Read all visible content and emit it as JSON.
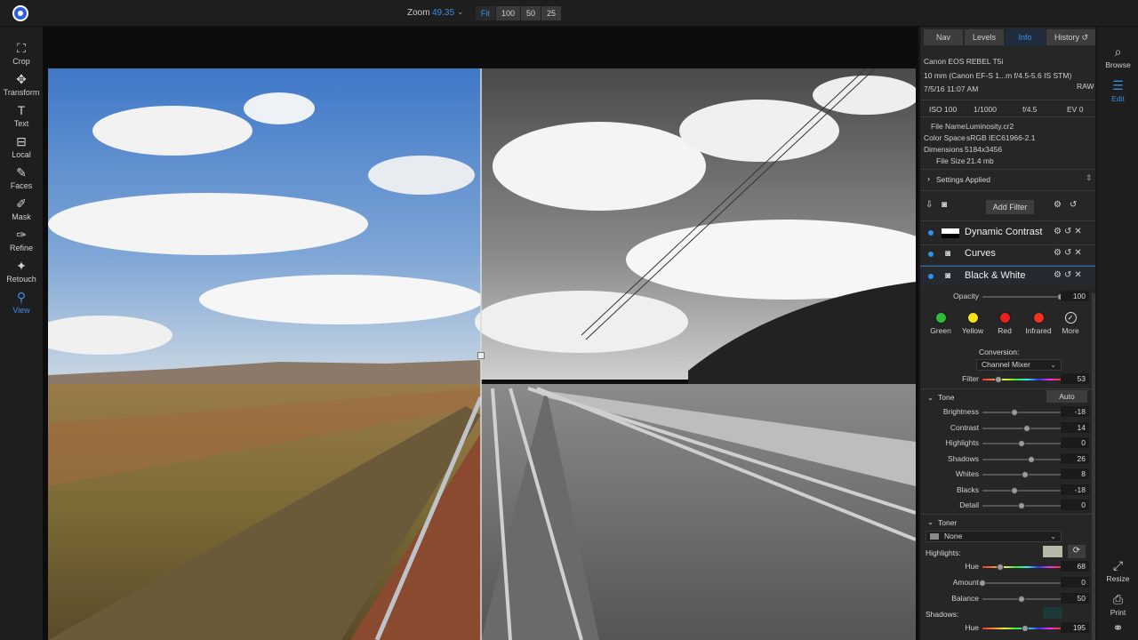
{
  "topbar": {
    "zoom_label": "Zoom",
    "zoom_value": "49.35",
    "zoom_buttons": [
      "Fit",
      "100",
      "50",
      "25"
    ]
  },
  "left_tools": [
    {
      "label": "Crop",
      "icon": "crop-icon"
    },
    {
      "label": "Transform",
      "icon": "transform-icon"
    },
    {
      "label": "Text",
      "icon": "text-icon"
    },
    {
      "label": "Local",
      "icon": "local-icon"
    },
    {
      "label": "Faces",
      "icon": "faces-icon"
    },
    {
      "label": "Mask",
      "icon": "mask-icon"
    },
    {
      "label": "Refine",
      "icon": "refine-icon"
    },
    {
      "label": "Retouch",
      "icon": "retouch-icon"
    },
    {
      "label": "View",
      "icon": "view-icon"
    }
  ],
  "right_tools": [
    {
      "label": "Browse",
      "icon": "browse-icon"
    },
    {
      "label": "Edit",
      "icon": "edit-icon"
    },
    {
      "label": "Resize",
      "icon": "resize-icon"
    },
    {
      "label": "Print",
      "icon": "print-icon"
    }
  ],
  "panel": {
    "tabs": [
      "Nav",
      "Levels",
      "Info",
      "History"
    ],
    "camera": "Canon EOS REBEL T5i",
    "lens": "10 mm (Canon EF-S 1...m f/4.5-5.6 IS STM)",
    "datetime": "7/5/16 11:07 AM",
    "format": "RAW",
    "exif": [
      "ISO 100",
      "1/1000",
      "f/4.5",
      "EV 0"
    ],
    "file_name_label": "File Name",
    "file_name": "Luminosity.cr2",
    "color_space_label": "Color Space",
    "color_space": "sRGB IEC61966-2.1",
    "dimensions_label": "Dimensions",
    "dimensions": "5184x3456",
    "file_size_label": "File Size",
    "file_size": "21.4 mb",
    "settings_applied": "Settings Applied",
    "add_filter": "Add Filter",
    "filters": [
      "Dynamic Contrast",
      "Curves",
      "Black & White"
    ],
    "opacity_label": "Opacity",
    "opacity_value": "100",
    "swatches": [
      {
        "label": "Green",
        "color": "#2ebd3a"
      },
      {
        "label": "Yellow",
        "color": "#f2e21a"
      },
      {
        "label": "Red",
        "color": "#e8201f"
      },
      {
        "label": "Infrared",
        "color": "#f0321e"
      },
      {
        "label": "More",
        "color": "#2a2a2a"
      }
    ],
    "conversion_label": "Conversion:",
    "conversion_value": "Channel Mixer",
    "filter_label": "Filter",
    "filter_value": "53",
    "tone_title": "Tone",
    "auto_label": "Auto",
    "tone_sliders": [
      {
        "label": "Brightness",
        "value": "-18",
        "pos": 0.41
      },
      {
        "label": "Contrast",
        "value": "14",
        "pos": 0.57
      },
      {
        "label": "Highlights",
        "value": "0",
        "pos": 0.5
      },
      {
        "label": "Shadows",
        "value": "26",
        "pos": 0.63
      },
      {
        "label": "Whites",
        "value": "8",
        "pos": 0.54
      },
      {
        "label": "Blacks",
        "value": "-18",
        "pos": 0.41
      },
      {
        "label": "Detail",
        "value": "0",
        "pos": 0.5
      }
    ],
    "toner_title": "Toner",
    "toner_value": "None",
    "highlights_label": "Highlights:",
    "hl_hue_label": "Hue",
    "hl_hue_value": "68",
    "amount_label": "Amount",
    "amount_value": "0",
    "balance_label": "Balance",
    "balance_value": "50",
    "shadows_label": "Shadows:",
    "sh_hue_label": "Hue",
    "sh_hue_value": "195"
  }
}
